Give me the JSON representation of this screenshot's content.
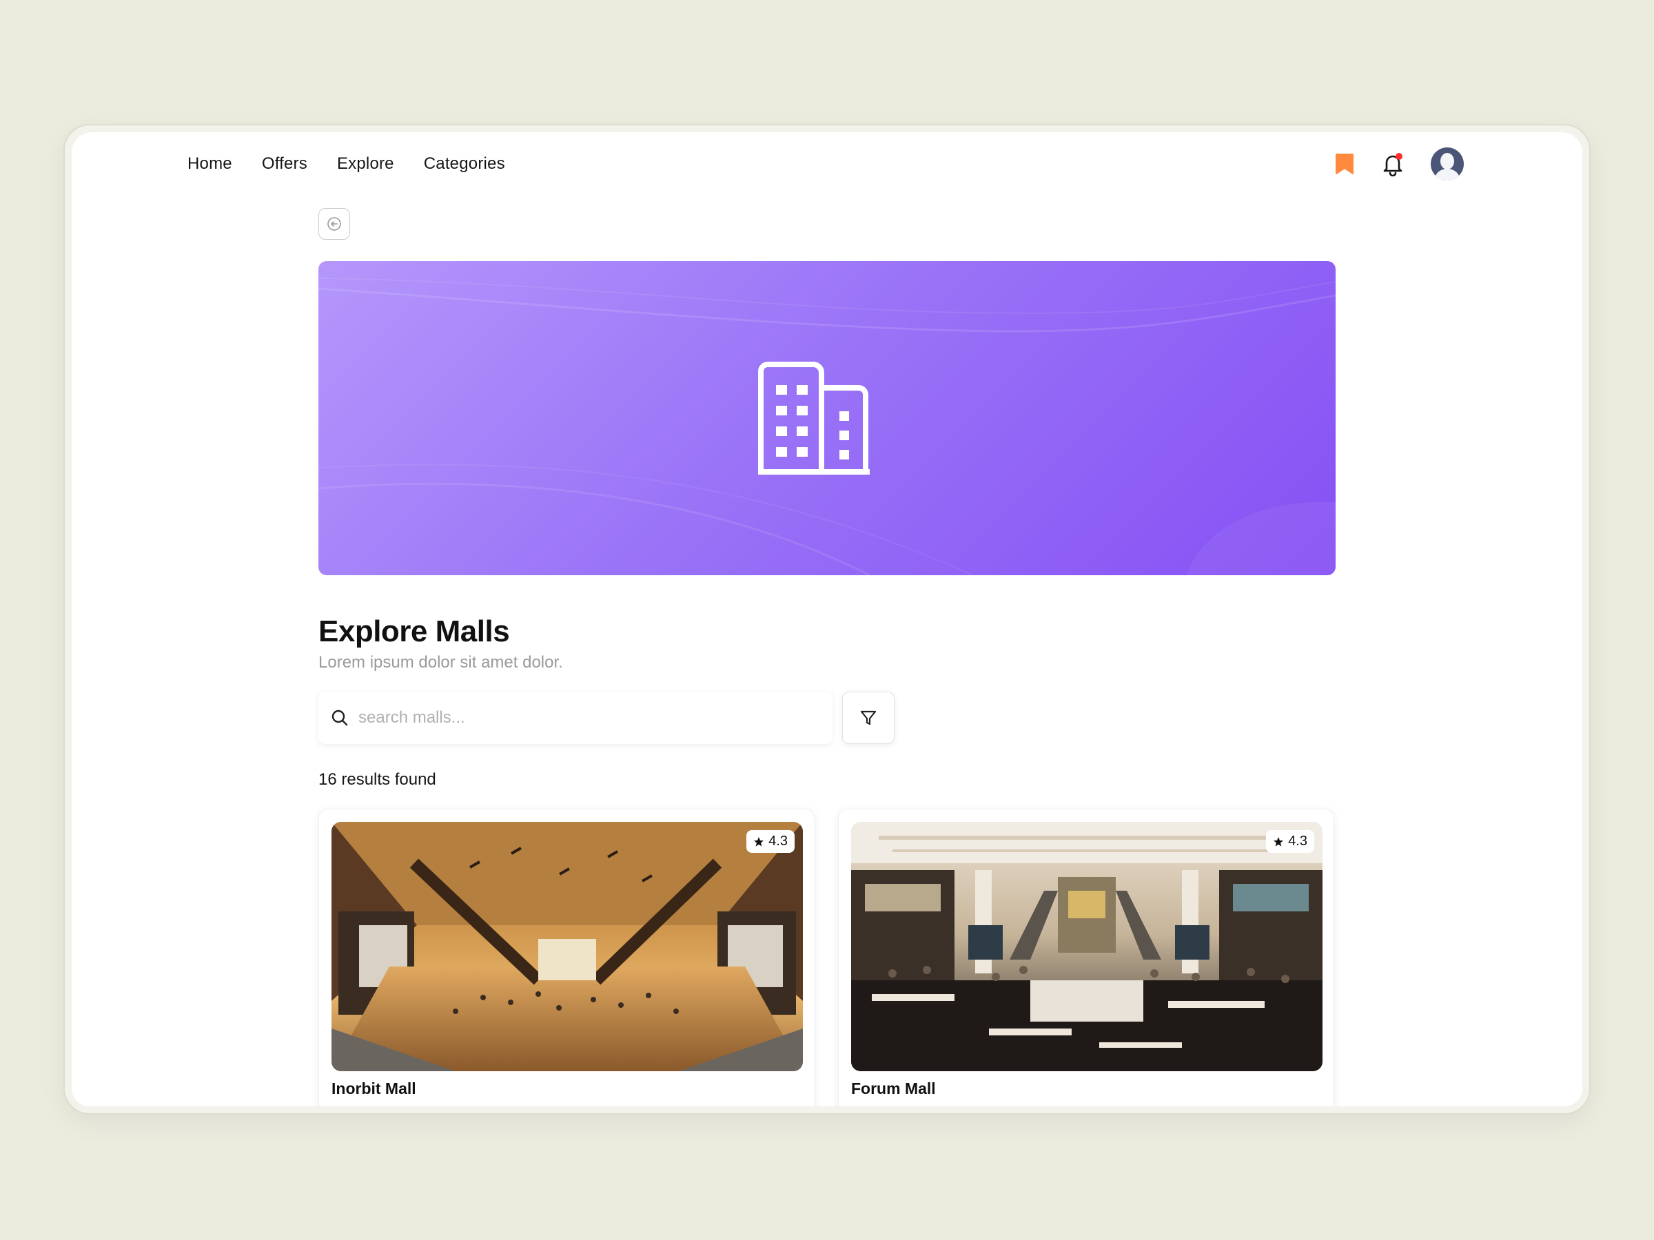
{
  "nav": {
    "items": [
      {
        "label": "Home"
      },
      {
        "label": "Offers"
      },
      {
        "label": "Explore"
      },
      {
        "label": "Categories"
      }
    ]
  },
  "header_icons": {
    "bookmark": {
      "icon": "bookmark-icon",
      "color": "#ff8a3d"
    },
    "notifications": {
      "icon": "bell-icon",
      "badge_color": "#ff2d2d"
    },
    "profile": {
      "icon": "avatar"
    }
  },
  "hero": {
    "icon": "building-icon",
    "gradient": [
      "#b597fb",
      "#8650f4"
    ]
  },
  "page": {
    "title": "Explore Malls",
    "subtitle": "Lorem ipsum dolor sit amet dolor."
  },
  "search": {
    "placeholder": "search malls...",
    "value": ""
  },
  "results": {
    "text": "16 results found"
  },
  "malls": [
    {
      "name": "Inorbit Mall",
      "rating": "4.3"
    },
    {
      "name": "Forum Mall",
      "rating": "4.3"
    }
  ]
}
